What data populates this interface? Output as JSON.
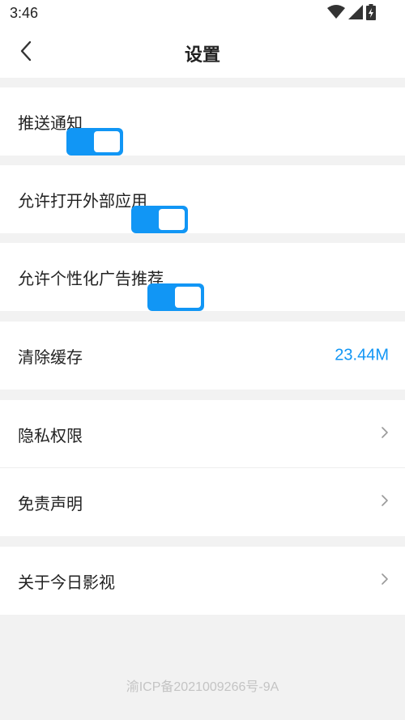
{
  "status_bar": {
    "time": "3:46",
    "icons": [
      "wifi-icon",
      "cellular-signal-icon",
      "battery-charging-icon"
    ]
  },
  "header": {
    "title": "设置",
    "back_icon": "chevron-left-icon"
  },
  "settings": {
    "push_notification": {
      "label": "推送通知",
      "enabled": true
    },
    "open_external_apps": {
      "label": "允许打开外部应用",
      "enabled": true
    },
    "personalized_ads": {
      "label": "允许个性化广告推荐",
      "enabled": true
    },
    "clear_cache": {
      "label": "清除缓存",
      "value": "23.44M"
    },
    "privacy_permissions": {
      "label": "隐私权限",
      "icon": "chevron-right-icon"
    },
    "disclaimer": {
      "label": "免责声明",
      "icon": "chevron-right-icon"
    },
    "about": {
      "label": "关于今日影视",
      "icon": "chevron-right-icon"
    }
  },
  "footer": {
    "icp": "渝ICP备2021009266号-9A"
  },
  "colors": {
    "accent": "#1196f5",
    "background": "#f2f2f2",
    "card": "#ffffff",
    "text": "#222222",
    "chevron": "#999999",
    "footer_text": "#c4c4c4"
  }
}
